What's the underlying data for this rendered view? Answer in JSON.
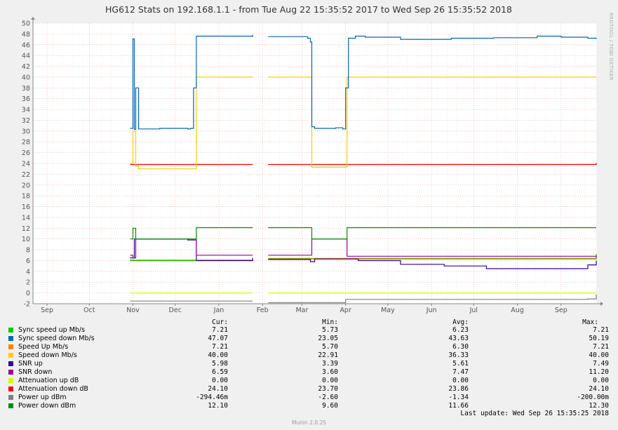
{
  "title": "HG612 Stats on 192.168.1.1 - from Tue Aug 22 15:35:52 2017 to Wed Sep 26 15:35:52 2018",
  "watermark": "RRDTOOL / TOBI OETIKER",
  "footer": "Munin 2.0.25",
  "last_update": "Last update: Wed Sep 26 15:35:25 2018",
  "columns": {
    "cur": "Cur:",
    "min": "Min:",
    "avg": "Avg:",
    "max": "Max:"
  },
  "legend": [
    {
      "label": "Sync speed up Mb/s",
      "color": "#00cc00",
      "cur": "7.21",
      "min": "5.73",
      "avg": "6.23",
      "max": "7.21"
    },
    {
      "label": "Sync speed down Mb/s",
      "color": "#0066b3",
      "cur": "47.07",
      "min": "23.05",
      "avg": "43.63",
      "max": "50.19"
    },
    {
      "label": "Speed Up Mb/s",
      "color": "#ff8000",
      "cur": "7.21",
      "min": "5.70",
      "avg": "6.30",
      "max": "7.21"
    },
    {
      "label": "Speed down Mb/s",
      "color": "#ffcc00",
      "cur": "40.00",
      "min": "22.91",
      "avg": "36.33",
      "max": "40.00"
    },
    {
      "label": "SNR up",
      "color": "#330099",
      "cur": "5.98",
      "min": "3.39",
      "avg": "5.61",
      "max": "7.49"
    },
    {
      "label": "SNR down",
      "color": "#990099",
      "cur": "6.59",
      "min": "3.60",
      "avg": "7.47",
      "max": "11.20"
    },
    {
      "label": "Attenuation up dB",
      "color": "#ccff00",
      "cur": "0.00",
      "min": "0.00",
      "avg": "0.00",
      "max": "0.00"
    },
    {
      "label": "Attenuation down dB",
      "color": "#ff0000",
      "cur": "24.10",
      "min": "23.70",
      "avg": "23.86",
      "max": "24.10"
    },
    {
      "label": "Power up dBm",
      "color": "#808080",
      "cur": "-294.46m",
      "min": "-2.60",
      "avg": "-1.34",
      "max": "-200.00m"
    },
    {
      "label": "Power down dBm",
      "color": "#008f00",
      "cur": "12.10",
      "min": "9.60",
      "avg": "11.66",
      "max": "12.30"
    }
  ],
  "chart_data": {
    "type": "line",
    "title": "HG612 Stats on 192.168.1.1 - from Tue Aug 22 15:35:52 2017 to Wed Sep 26 15:35:52 2018",
    "xlabel": "",
    "ylabel": "",
    "ylim": [
      -2,
      50
    ],
    "yticks": [
      -2,
      0,
      2,
      4,
      6,
      8,
      10,
      12,
      14,
      16,
      18,
      20,
      22,
      24,
      26,
      28,
      30,
      32,
      34,
      36,
      38,
      40,
      42,
      44,
      46,
      48,
      50
    ],
    "xlim": [
      "2017-08-22",
      "2018-09-26"
    ],
    "xticks": [
      {
        "label": "Sep",
        "date": "2017-09-01"
      },
      {
        "label": "Oct",
        "date": "2017-10-01"
      },
      {
        "label": "Nov",
        "date": "2017-11-01"
      },
      {
        "label": "Dec",
        "date": "2017-12-01"
      },
      {
        "label": "Jan",
        "date": "2018-01-01"
      },
      {
        "label": "Feb",
        "date": "2018-02-01"
      },
      {
        "label": "Mar",
        "date": "2018-03-01"
      },
      {
        "label": "Apr",
        "date": "2018-04-01"
      },
      {
        "label": "May",
        "date": "2018-05-01"
      },
      {
        "label": "Jun",
        "date": "2018-06-01"
      },
      {
        "label": "Jul",
        "date": "2018-07-01"
      },
      {
        "label": "Aug",
        "date": "2018-08-01"
      },
      {
        "label": "Sep",
        "date": "2018-09-01"
      }
    ],
    "grid": true,
    "series": [
      {
        "name": "Sync speed down Mb/s",
        "color": "#0066b3",
        "x": [
          "2017-10-30",
          "2017-11-01",
          "2017-11-02",
          "2017-11-03",
          "2017-11-05",
          "2017-11-20",
          "2017-12-10",
          "2017-12-12",
          "2017-12-14",
          "2017-12-16",
          "2018-01-10",
          "2018-01-25",
          null,
          "2018-02-05",
          "2018-03-05",
          "2018-03-07",
          "2018-03-08",
          "2018-03-10",
          "2018-03-25",
          "2018-03-30",
          "2018-04-01",
          "2018-04-03",
          "2018-04-08",
          "2018-04-15",
          "2018-05-10",
          "2018-06-15",
          "2018-07-15",
          "2018-08-15",
          "2018-09-01",
          "2018-09-20",
          "2018-09-26"
        ],
        "y": [
          30.5,
          47.1,
          30.3,
          38,
          30.4,
          30.5,
          30.4,
          30.5,
          38,
          47.6,
          47.6,
          47.8,
          null,
          47.5,
          47.2,
          46.5,
          30.8,
          30.5,
          30.6,
          30.4,
          38,
          47.2,
          47.6,
          47.4,
          47,
          47.2,
          47.3,
          47.6,
          47.4,
          47.2,
          47.07
        ]
      },
      {
        "name": "Speed down Mb/s",
        "color": "#ffcc00",
        "x": [
          "2017-10-30",
          "2017-11-01",
          "2017-11-03",
          "2017-11-05",
          "2017-12-14",
          "2017-12-16",
          "2018-01-25",
          null,
          "2018-02-05",
          "2018-03-06",
          "2018-03-08",
          "2018-04-01",
          "2018-04-02",
          "2018-09-26"
        ],
        "y": [
          24,
          30,
          23.5,
          23,
          23,
          40,
          40,
          null,
          40,
          40,
          23.3,
          23.3,
          40,
          40
        ]
      },
      {
        "name": "Attenuation down dB",
        "color": "#ff0000",
        "x": [
          "2017-10-30",
          "2018-01-25",
          null,
          "2018-02-05",
          "2018-09-24",
          "2018-09-26"
        ],
        "y": [
          23.8,
          23.8,
          null,
          23.8,
          23.8,
          24.1
        ]
      },
      {
        "name": "Power down dBm",
        "color": "#008f00",
        "x": [
          "2017-10-30",
          "2017-11-01",
          "2017-11-03",
          "2017-12-14",
          "2017-12-16",
          "2018-01-25",
          null,
          "2018-02-05",
          "2018-03-07",
          "2018-03-08",
          "2018-04-01",
          "2018-04-02",
          "2018-09-26"
        ],
        "y": [
          10,
          12,
          10,
          10,
          12.1,
          12.1,
          null,
          12.1,
          12.1,
          10,
          10,
          12.1,
          12.1
        ]
      },
      {
        "name": "SNR down",
        "color": "#990099",
        "x": [
          "2017-10-30",
          "2017-11-01",
          "2017-11-03",
          "2017-12-14",
          "2017-12-16",
          "2018-01-25",
          null,
          "2018-02-05",
          "2018-03-07",
          "2018-03-08",
          "2018-04-01",
          "2018-04-02",
          "2018-06-15",
          "2018-09-26"
        ],
        "y": [
          7,
          6.5,
          10,
          10,
          7,
          7,
          null,
          7,
          7,
          10,
          10,
          6.8,
          6.8,
          6.59
        ]
      },
      {
        "name": "SNR up",
        "color": "#330099",
        "x": [
          "2017-10-30",
          "2017-11-02",
          "2017-11-05",
          "2017-12-10",
          "2017-12-16",
          "2018-01-25",
          null,
          "2018-02-05",
          "2018-03-07",
          "2018-03-10",
          "2018-04-10",
          "2018-05-10",
          "2018-06-10",
          "2018-07-10",
          "2018-08-10",
          "2018-09-20",
          "2018-09-26"
        ],
        "y": [
          6.5,
          10,
          10,
          9.8,
          6,
          6.5,
          null,
          6.2,
          5.8,
          6.3,
          6,
          5.3,
          5,
          4.5,
          4.5,
          5.2,
          5.98
        ]
      },
      {
        "name": "Sync speed up Mb/s",
        "color": "#00cc00",
        "x": [
          "2017-10-30",
          "2018-01-25",
          null,
          "2018-02-05",
          "2018-09-26"
        ],
        "y": [
          6,
          6,
          null,
          6.3,
          7.21
        ]
      },
      {
        "name": "Speed Up Mb/s",
        "color": "#ff8000",
        "x": [
          "2017-10-30",
          "2018-01-25",
          null,
          "2018-02-05",
          "2018-09-26"
        ],
        "y": [
          6.1,
          6.1,
          null,
          6.4,
          7.21
        ]
      },
      {
        "name": "Attenuation up dB",
        "color": "#ccff00",
        "x": [
          "2017-10-30",
          "2018-01-25",
          null,
          "2018-02-05",
          "2018-09-26"
        ],
        "y": [
          0,
          0,
          null,
          0,
          0
        ]
      },
      {
        "name": "Power up dBm",
        "color": "#808080",
        "x": [
          "2017-10-30",
          "2018-01-25",
          null,
          "2018-02-05",
          "2018-04-01",
          "2018-09-20",
          "2018-09-26"
        ],
        "y": [
          -1.5,
          -1.5,
          null,
          -1.8,
          -1.2,
          -1.1,
          -0.29
        ]
      }
    ]
  }
}
